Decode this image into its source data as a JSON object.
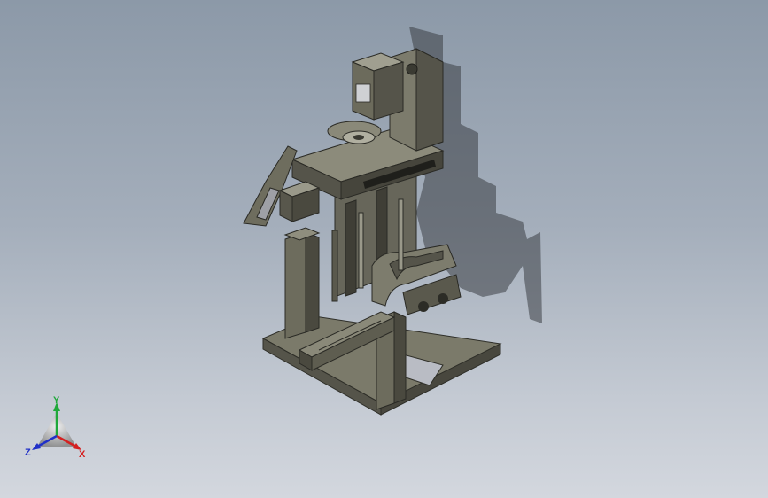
{
  "viewport": {
    "background_top": "#8c99a8",
    "background_bottom": "#d3d7de",
    "model_color": "#6f6e5f",
    "model_dark": "#3d3d34",
    "model_light": "#a09f90",
    "shadow_color": "#3a3e44"
  },
  "triad": {
    "x_label": "X",
    "y_label": "Y",
    "z_label": "Z",
    "x_color": "#d42020",
    "y_color": "#1fa83a",
    "z_color": "#2030c8"
  }
}
